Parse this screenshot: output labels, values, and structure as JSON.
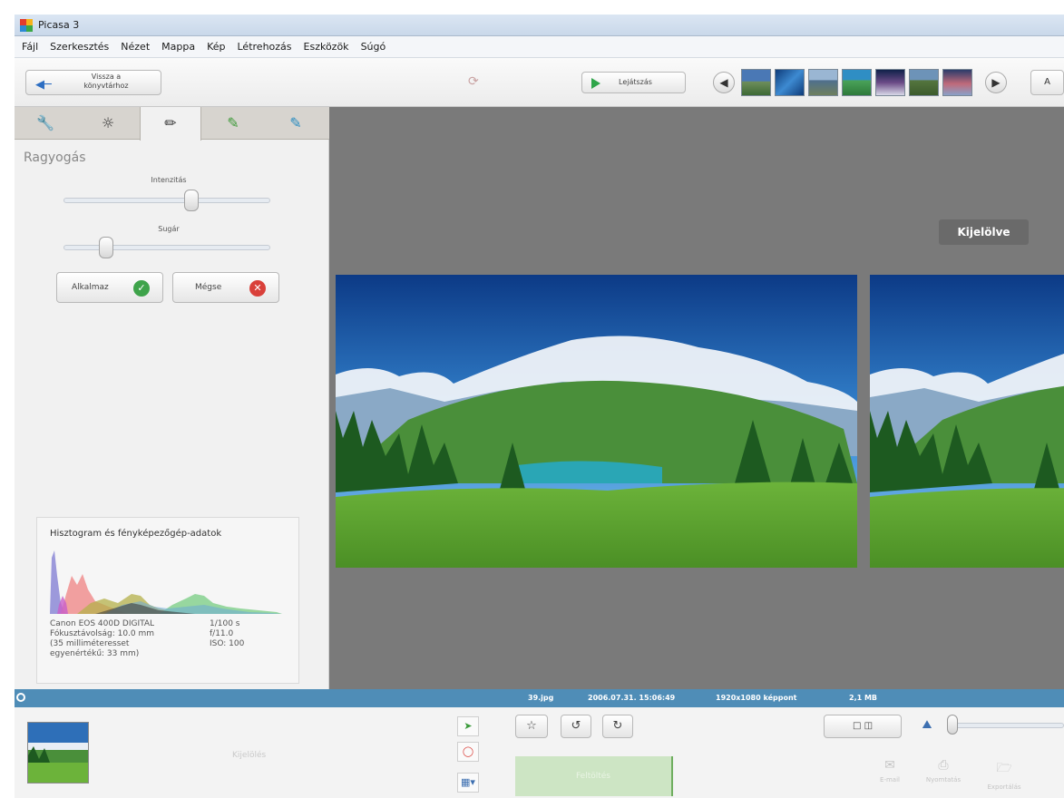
{
  "window": {
    "title": "Picasa 3"
  },
  "menu": [
    "Fájl",
    "Szerkesztés",
    "Nézet",
    "Mappa",
    "Kép",
    "Létrehozás",
    "Eszközök",
    "Súgó"
  ],
  "toolbar": {
    "back_label_line1": "Vissza a",
    "back_label_line2": "könyvtárhoz",
    "play_label": "Lejátszás",
    "end_button": "A"
  },
  "left_panel": {
    "effect_title": "Ragyogás",
    "slider1_label": "Intenzitás",
    "slider2_label": "Sugár",
    "slider1_level": 0.62,
    "slider2_level": 0.2,
    "apply_label": "Alkalmaz",
    "cancel_label": "Mégse"
  },
  "histogram": {
    "title": "Hisztogram és fényképezőgép-adatok",
    "camera": "Canon EOS 400D DIGITAL",
    "focal": "Fókusztávolság: 10.0 mm",
    "equiv1": "(35 milliméteresset",
    "equiv2": "egyenértékű: 33 mm)",
    "shutter": "1/100 s",
    "aperture": "f/11.0",
    "iso": "ISO: 100"
  },
  "main": {
    "selected_badge": "Kijelölve"
  },
  "status": {
    "filename": "39.jpg",
    "datetime": "2006.07.31. 15:06:49",
    "dimensions": "1920x1080 képpont",
    "size": "2,1 MB"
  },
  "tray": {
    "selection_label": "Kijelölés",
    "upload_label": "Feltöltés",
    "email_label": "E-mail",
    "print_label": "Nyomtatás",
    "export_label": "Exportálás"
  },
  "colors": {
    "status_bar": "#4f8db7",
    "accent_green": "#2fa54a",
    "cancel_red": "#d9403a"
  }
}
